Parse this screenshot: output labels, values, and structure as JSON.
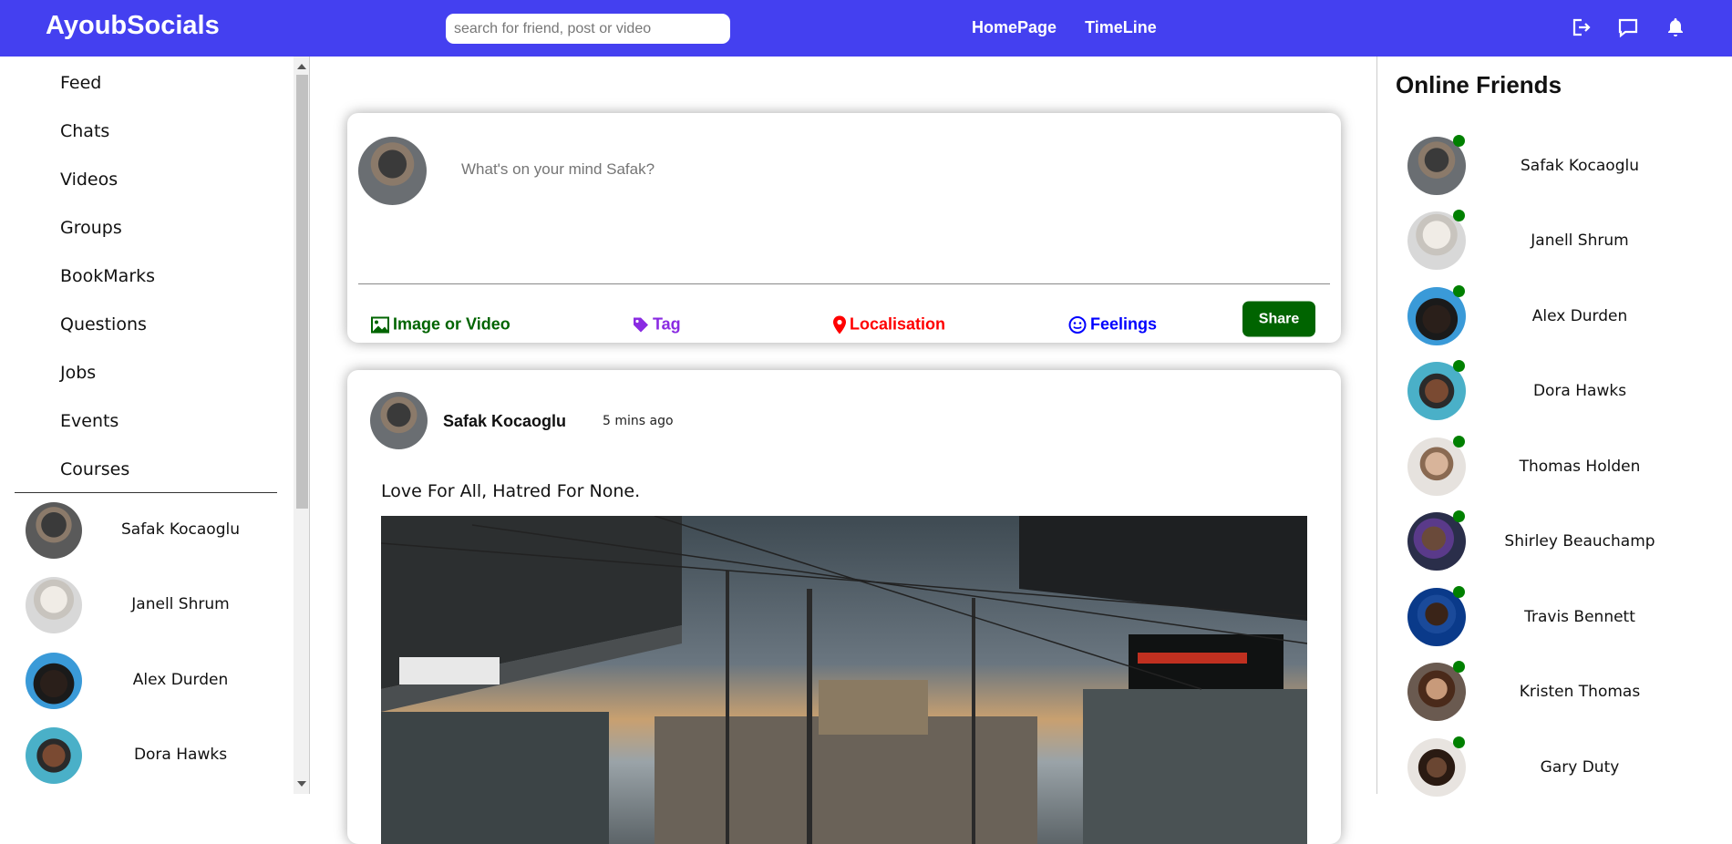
{
  "topbar": {
    "logo": "AyoubSocials",
    "search_placeholder": "search for friend, post or video",
    "nav": [
      "HomePage",
      "TimeLine"
    ],
    "icons": [
      "logout-icon",
      "chat-icon",
      "bell-icon"
    ],
    "color": "#4440f0"
  },
  "sidebar": {
    "menu": [
      "Feed",
      "Chats",
      "Videos",
      "Groups",
      "BookMarks",
      "Questions",
      "Jobs",
      "Events",
      "Courses"
    ],
    "friends": [
      "Safak Kocaoglu",
      "Janell Shrum",
      "Alex Durden",
      "Dora Hawks"
    ]
  },
  "share": {
    "placeholder": "What's on your mind Safak?",
    "options": [
      {
        "label": "Image or Video",
        "color": "#006400",
        "icon": "image-icon"
      },
      {
        "label": "Tag",
        "color": "#8a2be2",
        "icon": "tag-icon"
      },
      {
        "label": "Localisation",
        "color": "#ff0000",
        "icon": "location-pin-icon"
      },
      {
        "label": "Feelings",
        "color": "#0000ff",
        "icon": "smiley-icon"
      }
    ],
    "button": "Share",
    "button_color": "#006400"
  },
  "post": {
    "user": "Safak Kocaoglu",
    "time": "5 mins ago",
    "text": "Love For All, Hatred For None."
  },
  "rightbar": {
    "title": "Online Friends",
    "friends": [
      "Safak Kocaoglu",
      "Janell Shrum",
      "Alex Durden",
      "Dora Hawks",
      "Thomas Holden",
      "Shirley Beauchamp",
      "Travis Bennett",
      "Kristen Thomas",
      "Gary Duty"
    ],
    "online_color": "#008000"
  }
}
